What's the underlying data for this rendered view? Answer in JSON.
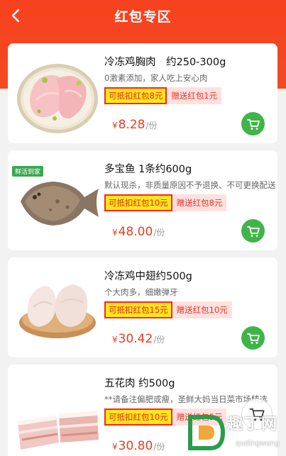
{
  "colors": {
    "header": "#f6421e",
    "price": "#ef3b1e",
    "cart": "#3fb549",
    "tag_border": "#ff2419",
    "tag_fill": "#ffe71b",
    "gift_bg": "#ffe1df"
  },
  "header": {
    "title": "红包专区",
    "back_icon": "chevron-left-icon"
  },
  "products": [
    {
      "name": "冷冻鸡胸肉　约250-300g",
      "desc": "0激素添加，家人吃上安心肉",
      "coupon": "可抵扣红包8元",
      "gift": "赠送红包1元",
      "yen": "¥",
      "price": "8.28",
      "unit": "/份",
      "image": "chicken-breast-image",
      "badge": ""
    },
    {
      "name": "多宝鱼 1条约600g",
      "desc": "默认现杀，非质量原因不予退换、不可更换配送",
      "coupon": "可抵扣红包10元",
      "gift": "赠送红包8元",
      "yen": "¥",
      "price": "48.00",
      "unit": "/份",
      "image": "turbot-fish-image",
      "badge": "鲜活到家"
    },
    {
      "name": "冷冻鸡中翅约500g",
      "desc": "个大肉多，细嫩弹牙",
      "coupon": "可抵扣红包15元",
      "gift": "赠送红包10元",
      "yen": "¥",
      "price": "30.42",
      "unit": "/份",
      "image": "chicken-wings-image",
      "badge": ""
    },
    {
      "name": "五花肉 约500g",
      "desc": "**请备注偏肥或瘦，圣鲜大妈当日菜市场精选",
      "coupon": "可抵扣红包10元",
      "gift": "赠送红包5元",
      "yen": "¥",
      "price": "30.80",
      "unit": "/份",
      "image": "pork-belly-image",
      "badge": ""
    }
  ],
  "watermark": {
    "text": "趣丁网",
    "sub": "qudingwang"
  }
}
